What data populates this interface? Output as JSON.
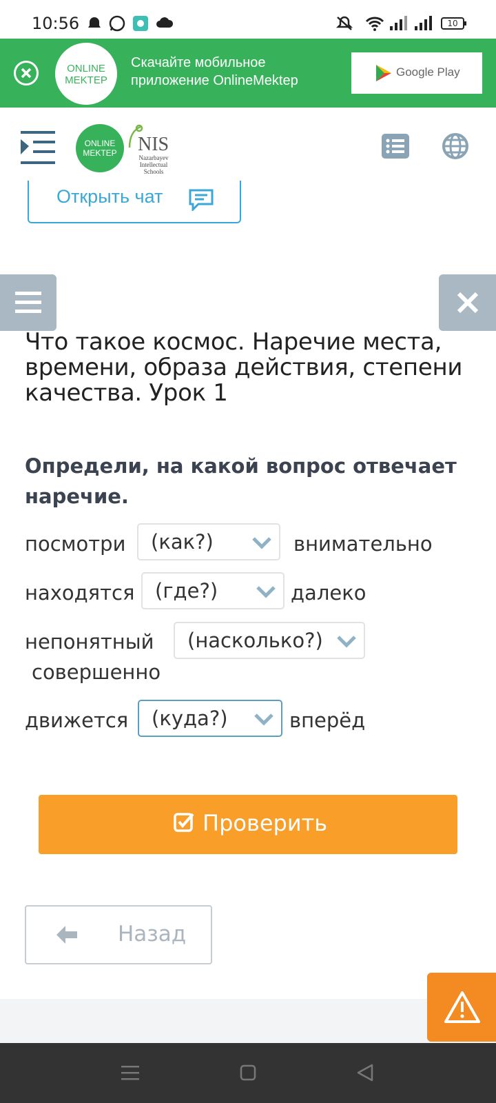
{
  "status_bar": {
    "time": "10:56",
    "battery": "10"
  },
  "banner": {
    "logo_line1": "ONLINE",
    "logo_line2": "MEKTEP",
    "text": "Скачайте мобильное приложение OnlineMektep",
    "store_label": "Google Play"
  },
  "header": {
    "logo_line1": "ONLINE",
    "logo_line2": "MEKTEP",
    "nis_title": "NIS",
    "nis_subtitle": "Nazarbayev Intellectual Schools"
  },
  "chat_button": {
    "label": "Открыть чат"
  },
  "lesson": {
    "title": "Что такое космос. Наречие места, времени, образа действия, степени качества. Урок 1",
    "question": "Определи, на какой вопрос отвечает наречие."
  },
  "rows": [
    {
      "left": "посмотри",
      "selected": "(как?)",
      "right": "внимательно"
    },
    {
      "left": "находятся",
      "selected": "(где?)",
      "right": "далеко"
    },
    {
      "left": "непонятный",
      "selected": "(насколько?)",
      "right": "совершенно"
    },
    {
      "left": "движется",
      "selected": "(куда?)",
      "right": "вперёд"
    }
  ],
  "check_button": {
    "label": "Проверить"
  },
  "back_button": {
    "label": "Назад"
  },
  "colors": {
    "green": "#37b25b",
    "accent_blue": "#3aa7d8",
    "orange": "#fa9e2a",
    "side_gray": "#a9b8c3"
  }
}
